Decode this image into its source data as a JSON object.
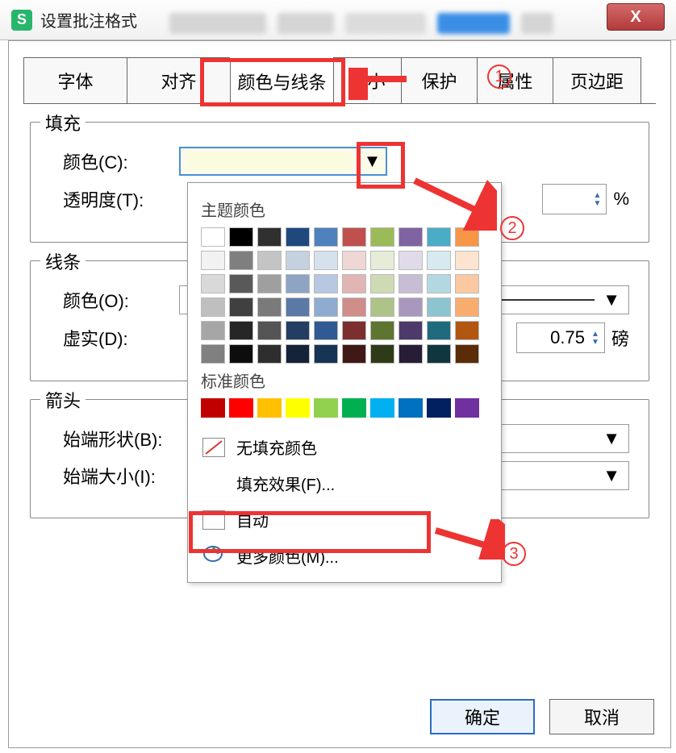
{
  "window": {
    "app_letter": "S",
    "title": "设置批注格式",
    "close": "X"
  },
  "tabs": [
    "字体",
    "对齐",
    "颜色与线条",
    "大小",
    "保护",
    "属性",
    "页边距"
  ],
  "active_tab": 2,
  "fill": {
    "legend": "填充",
    "color_label": "颜色(C):",
    "transparency_label": "透明度(T):",
    "pct": "%"
  },
  "line": {
    "legend": "线条",
    "color_label": "颜色(O):",
    "dash_label": "虚实(D):",
    "weight_value": "0.75",
    "weight_unit": "磅"
  },
  "arrow": {
    "legend": "箭头",
    "begin_shape": "始端形状(B):",
    "begin_size": "始端大小(I):"
  },
  "panel": {
    "theme": "主题颜色",
    "standard": "标准颜色",
    "no_fill": "无填充颜色",
    "fill_effects": "填充效果(F)...",
    "auto": "自动",
    "more_colors": "更多颜色(M)..."
  },
  "theme_colors": [
    [
      "#ffffff",
      "#000000",
      "#303030",
      "#1f497d",
      "#4f81bd",
      "#c0504d",
      "#9bbb59",
      "#8064a2",
      "#4bacc6",
      "#f79646"
    ],
    [
      "#f2f2f2",
      "#7f7f7f",
      "#c4c4c4",
      "#c6d1e0",
      "#d7e1ee",
      "#efd7d6",
      "#e5edd8",
      "#e1dbe9",
      "#d6eaef",
      "#fde4d0"
    ],
    [
      "#d9d9d9",
      "#595959",
      "#9f9f9f",
      "#8ea4c4",
      "#b6c8e2",
      "#e0b5b3",
      "#cddab3",
      "#c7bed5",
      "#b4d8e1",
      "#fbc9a1"
    ],
    [
      "#bfbfbf",
      "#404040",
      "#7a7a7a",
      "#5a79a6",
      "#8fabcf",
      "#cf8e8a",
      "#aec387",
      "#a998bd",
      "#8cc4d0",
      "#f8ad6f"
    ],
    [
      "#a6a6a6",
      "#262626",
      "#555555",
      "#233d63",
      "#2f5a93",
      "#7c2f2c",
      "#5d7530",
      "#4d3a6a",
      "#1f6a7c",
      "#b25711"
    ],
    [
      "#808080",
      "#0d0d0d",
      "#2e2e2e",
      "#142338",
      "#163454",
      "#401816",
      "#2f3b18",
      "#281d37",
      "#103640",
      "#5a2c08"
    ]
  ],
  "standard_colors": [
    "#c00000",
    "#ff0000",
    "#ffc000",
    "#ffff00",
    "#92d050",
    "#00b050",
    "#00b0f0",
    "#0070c0",
    "#002060",
    "#7030a0"
  ],
  "buttons": {
    "ok": "确定",
    "cancel": "取消"
  },
  "anno": {
    "n1": "1",
    "n2": "2",
    "n3": "3"
  }
}
